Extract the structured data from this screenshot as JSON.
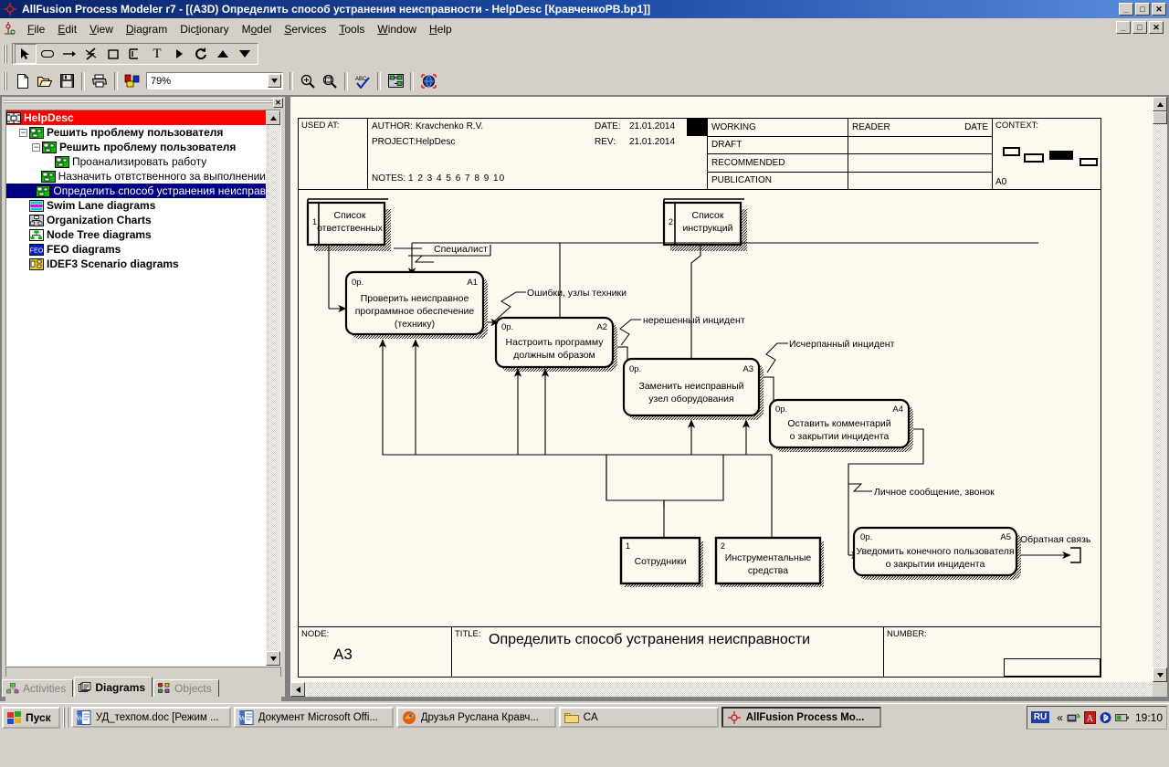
{
  "window": {
    "title": "AllFusion Process Modeler r7 - [(A3D) Определить способ устранения неисправности - HelpDesc  [КравченкоРВ.bp1]]",
    "minimize": "_",
    "maximize": "□",
    "close": "✕"
  },
  "menu": [
    {
      "label": "File"
    },
    {
      "label": "Edit"
    },
    {
      "label": "View"
    },
    {
      "label": "Diagram"
    },
    {
      "label": "Dictionary"
    },
    {
      "label": "Model"
    },
    {
      "label": "Services"
    },
    {
      "label": "Tools"
    },
    {
      "label": "Window"
    },
    {
      "label": "Help"
    }
  ],
  "drawing_toolbar": [
    {
      "name": "pointer-tool",
      "glyph": "➤"
    },
    {
      "name": "activity-box-tool",
      "glyph": "▭"
    },
    {
      "name": "arrow-tool",
      "glyph": "→"
    },
    {
      "name": "squiggle-tool",
      "glyph": "ϟ"
    },
    {
      "name": "text-box-tool",
      "glyph": "▢"
    },
    {
      "name": "offpage-ref-tool",
      "glyph": "⊏"
    },
    {
      "name": "text-tool",
      "glyph": "T"
    },
    {
      "name": "tunnel-tool",
      "glyph": "▶"
    },
    {
      "name": "rotate-tool",
      "glyph": "↺"
    },
    {
      "name": "up-tool",
      "glyph": "▲"
    },
    {
      "name": "down-tool",
      "glyph": "▼"
    }
  ],
  "standard_toolbar": {
    "new": "new-file-icon",
    "open": "open-folder-icon",
    "save": "save-disk-icon",
    "print": "printer-icon",
    "colors": "colors-icon",
    "zoom_value": "79%",
    "zoom_dropdown_glyph": "▼",
    "zoom_in": "zoom-in-icon",
    "fit": "fit-window-icon",
    "spell": "spell-check-icon",
    "report": "report-icon",
    "globe": "publish-web-icon"
  },
  "explorer": {
    "close_glyph": "✕",
    "tree": [
      {
        "level": 0,
        "label": "HelpDesc",
        "icon": "model-icon",
        "state": "root",
        "expander": ""
      },
      {
        "level": 1,
        "label": "Решить проблему пользователя",
        "icon": "activity-icon",
        "state": "bold",
        "expander": "−"
      },
      {
        "level": 2,
        "label": "Решить проблему пользователя",
        "icon": "activity-icon",
        "state": "bold",
        "expander": "−"
      },
      {
        "level": 3,
        "label": "Проанализировать  работу",
        "icon": "activity-icon",
        "state": "normal",
        "expander": ""
      },
      {
        "level": 3,
        "label": "Назначить отвтственного за  выполнении",
        "icon": "activity-icon",
        "state": "normal",
        "expander": ""
      },
      {
        "level": 3,
        "label": "Определить способ устранения неисправ",
        "icon": "activity-icon",
        "state": "selected",
        "expander": ""
      },
      {
        "level": 1,
        "label": "Swim Lane diagrams",
        "icon": "swimlane-icon",
        "state": "bold",
        "expander": ""
      },
      {
        "level": 1,
        "label": "Organization Charts",
        "icon": "orgchart-icon",
        "state": "bold",
        "expander": ""
      },
      {
        "level": 1,
        "label": "Node Tree diagrams",
        "icon": "nodetree-icon",
        "state": "bold",
        "expander": ""
      },
      {
        "level": 1,
        "label": "FEO diagrams",
        "icon": "feo-icon",
        "state": "bold",
        "expander": ""
      },
      {
        "level": 1,
        "label": "IDEF3 Scenario diagrams",
        "icon": "idef3-icon",
        "state": "bold",
        "expander": ""
      }
    ],
    "tabs": [
      {
        "label": "Activities",
        "icon": "activities-tab-icon",
        "active": false
      },
      {
        "label": "Diagrams",
        "icon": "diagrams-tab-icon",
        "active": true
      },
      {
        "label": "Objects",
        "icon": "objects-tab-icon",
        "active": false
      }
    ]
  },
  "idef_header": {
    "used_at_label": "USED AT:",
    "author_label": "AUTHOR:",
    "author_value": "Kravchenko R.V.",
    "project_label": "PROJECT:",
    "project_value": "HelpDesc",
    "date_label": "DATE:",
    "date_value": "21.01.2014",
    "rev_label": "REV:",
    "rev_value": "21.01.2014",
    "notes_label": "NOTES:",
    "notes_value": "1  2  3  4  5  6  7  8  9  10",
    "status_rows": [
      "WORKING",
      "DRAFT",
      "RECOMMENDED",
      "PUBLICATION"
    ],
    "reader_label": "READER",
    "date_col_label": "DATE",
    "context_label": "CONTEXT:",
    "context_node": "A0"
  },
  "idef_footer": {
    "node_label": "NODE:",
    "node_value": "A3",
    "title_label": "TITLE:",
    "title_value": "Определить способ устранения неисправности",
    "number_label": "NUMBER:",
    "number_value": ""
  },
  "chart_data": {
    "type": "diagram",
    "notation": "IDEF0",
    "activities": [
      {
        "id": "A1",
        "label": "Проверить неисправное программное обеспечение (технику)",
        "corner": "0р."
      },
      {
        "id": "A2",
        "label": "Настроить программу должным образом",
        "corner": "0р."
      },
      {
        "id": "A3",
        "label": "Заменить неисправный узел оборудования",
        "corner": "0р."
      },
      {
        "id": "A4",
        "label": "Оставить комментарий о закрытии инцидента",
        "corner": "0р."
      },
      {
        "id": "A5",
        "label": "Уведомить конечного пользователя о закрытии инцидента",
        "corner": "0р."
      }
    ],
    "external_refs": [
      {
        "num": "1",
        "label": "Список ответственных"
      },
      {
        "num": "2",
        "label": "Список инструкций"
      },
      {
        "num": "1",
        "label": "Сотрудники"
      },
      {
        "num": "2",
        "label": "Инструментальные средства"
      }
    ],
    "arrow_labels": [
      "Специалист",
      "Ошибки, узлы техники",
      "нерешенный инцидент",
      "Исчерпанный инцидент",
      "Личное сообщение, звонок",
      "Обратная связь"
    ]
  },
  "taskbar": {
    "start_label": "Пуск",
    "items": [
      {
        "label": "УД_техпом.doc [Режим ...",
        "icon": "word-icon",
        "active": false
      },
      {
        "label": "Документ Microsoft Offi...",
        "icon": "word-icon",
        "active": false
      },
      {
        "label": "Друзья Руслана Кравч...",
        "icon": "firefox-icon",
        "active": false
      },
      {
        "label": "CA",
        "icon": "folder-icon",
        "active": false
      },
      {
        "label": "AllFusion Process Mo...",
        "icon": "allfusion-icon",
        "active": true
      }
    ],
    "lang": "RU",
    "tray_glyph": "«",
    "tray_icons": [
      "network-icon",
      "acrobat-icon",
      "bluetooth-icon",
      "battery-icon"
    ],
    "clock": "19:10"
  }
}
